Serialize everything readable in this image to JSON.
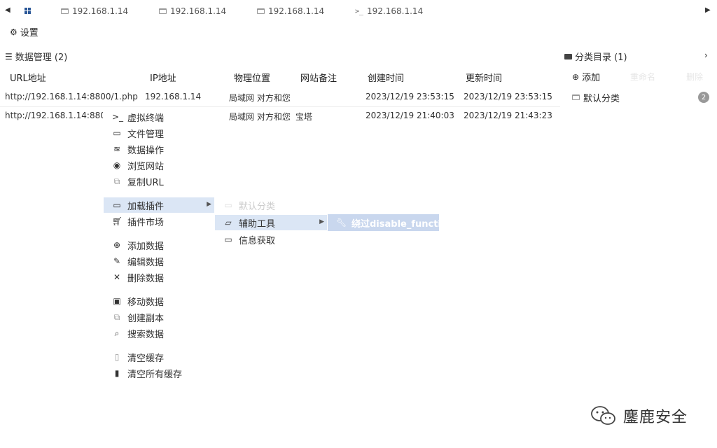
{
  "tabs": [
    {
      "label": "192.168.1.14",
      "icon": "folder-icon"
    },
    {
      "label": "192.168.1.14",
      "icon": "folder-icon"
    },
    {
      "label": "192.168.1.14",
      "icon": "folder-icon"
    },
    {
      "label": "192.168.1.14",
      "icon": "terminal-icon"
    }
  ],
  "toolbar": {
    "settings_label": "设置"
  },
  "data_panel": {
    "title": "数据管理 (2)"
  },
  "columns": [
    "URL地址",
    "IP地址",
    "物理位置",
    "网站备注",
    "创建时间",
    "更新时间"
  ],
  "rows": [
    {
      "url": "http://192.168.1.14:8800/1.php",
      "ip": "192.168.1.14",
      "location": "局域网 对方和您",
      "note": "",
      "created": "2023/12/19 23:53:15",
      "updated": "2023/12/19 23:53:15"
    },
    {
      "url": "http://192.168.1.14:880",
      "ip": "",
      "location": "局域网 对方和您",
      "note": "宝塔",
      "created": "2023/12/19 21:40:03",
      "updated": "2023/12/19 21:43:23"
    }
  ],
  "category_panel": {
    "title": "分类目录 (1)",
    "add_label": "添加",
    "rename_label": "重命名",
    "delete_label": "删除",
    "items": [
      {
        "label": "默认分类",
        "count": "2"
      }
    ]
  },
  "context_menu": {
    "items": [
      {
        "label": "虚拟终端",
        "icon": "terminal-icon"
      },
      {
        "label": "文件管理",
        "icon": "folder-icon"
      },
      {
        "label": "数据操作",
        "icon": "database-icon"
      },
      {
        "label": "浏览网站",
        "icon": "chrome-icon"
      },
      {
        "label": "复制URL",
        "icon": "copy-icon"
      },
      {
        "label": "加载插件",
        "icon": "folder-icon"
      },
      {
        "label": "插件市场",
        "icon": "cart-icon"
      },
      {
        "label": "添加数据",
        "icon": "plus-circle-icon"
      },
      {
        "label": "编辑数据",
        "icon": "edit-icon"
      },
      {
        "label": "删除数据",
        "icon": "close-icon"
      },
      {
        "label": "移动数据",
        "icon": "move-icon"
      },
      {
        "label": "创建副本",
        "icon": "copy-icon"
      },
      {
        "label": "搜索数据",
        "icon": "search-icon"
      },
      {
        "label": "清空缓存",
        "icon": "trash-outline-icon"
      },
      {
        "label": "清空所有缓存",
        "icon": "trash-icon"
      }
    ]
  },
  "plugin_submenu": {
    "items": [
      {
        "label": "默认分类",
        "icon": "folder-icon"
      },
      {
        "label": "辅助工具",
        "icon": "folder-open-icon"
      },
      {
        "label": "信息获取",
        "icon": "folder-icon"
      }
    ]
  },
  "tools_submenu": {
    "items": [
      {
        "label": "绕过disable_functions",
        "icon": "wrench-icon"
      }
    ]
  },
  "watermark": {
    "text": "鏖鹿安全"
  },
  "colors": {
    "menu_active": "#dbe6f5",
    "tool_item": "#c9d7ee",
    "badge": "#999999",
    "windows_blue": "#2b5797"
  }
}
